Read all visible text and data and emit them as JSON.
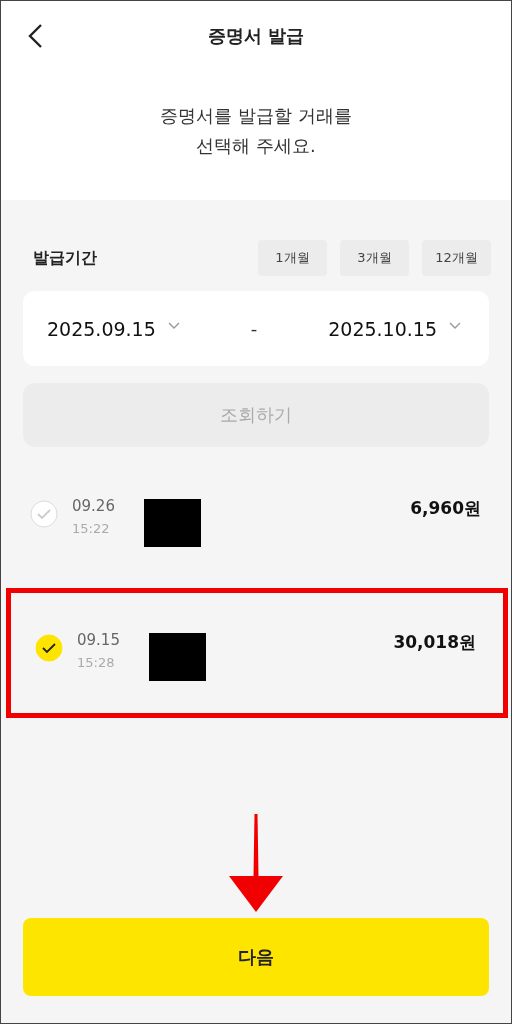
{
  "header": {
    "title": "증명서 발급"
  },
  "prompt": [
    "증명서를 발급할 거래를",
    "선택해 주세요."
  ],
  "period": {
    "label": "발급기간",
    "chips": [
      {
        "label": "1개월",
        "selected": false
      },
      {
        "label": "3개월",
        "selected": false
      },
      {
        "label": "12개월",
        "selected": false
      }
    ],
    "start": "2025.09.15",
    "separator": "-",
    "end": "2025.10.15"
  },
  "query_button": {
    "label": "조회하기",
    "disabled": true
  },
  "transactions": [
    {
      "date": "09.26",
      "time": "15:22",
      "amount": "6,960원",
      "selected": false,
      "redacted": true,
      "highlighted": false
    },
    {
      "date": "09.15",
      "time": "15:28",
      "amount": "30,018원",
      "selected": true,
      "redacted": true,
      "highlighted": true
    }
  ],
  "next_button": {
    "label": "다음",
    "pointer_arrow": true
  }
}
